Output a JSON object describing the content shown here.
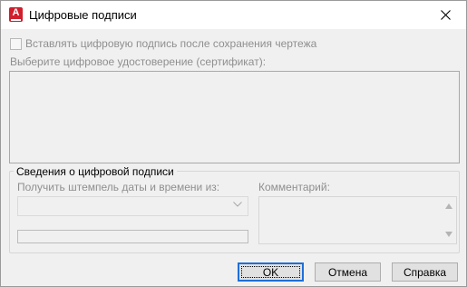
{
  "window": {
    "title": "Цифровые подписи",
    "app_icon_letter": "A"
  },
  "options": {
    "attach_signature_label": "Вставлять цифровую подпись после сохранения чертежа",
    "attach_signature_checked": false,
    "select_certificate_label": "Выберите цифровое удостоверение (сертификат):"
  },
  "signature_info": {
    "group_title": "Сведения о цифровой подписи",
    "timestamp_label": "Получить штемпель даты и времени из:",
    "timestamp_value": "",
    "comment_label": "Комментарий:"
  },
  "buttons": {
    "ok": "OK",
    "cancel": "Отмена",
    "help": "Справка"
  },
  "icons": {
    "close": "close-icon",
    "app": "autocad-icon",
    "dropdown": "chevron-down-icon",
    "scroll_up": "scroll-up-arrow-icon",
    "scroll_down": "scroll-down-arrow-icon"
  },
  "colors": {
    "accent": "#1e6fd9",
    "app_icon": "#d01e2c",
    "disabled_text": "#8f8f8f"
  }
}
